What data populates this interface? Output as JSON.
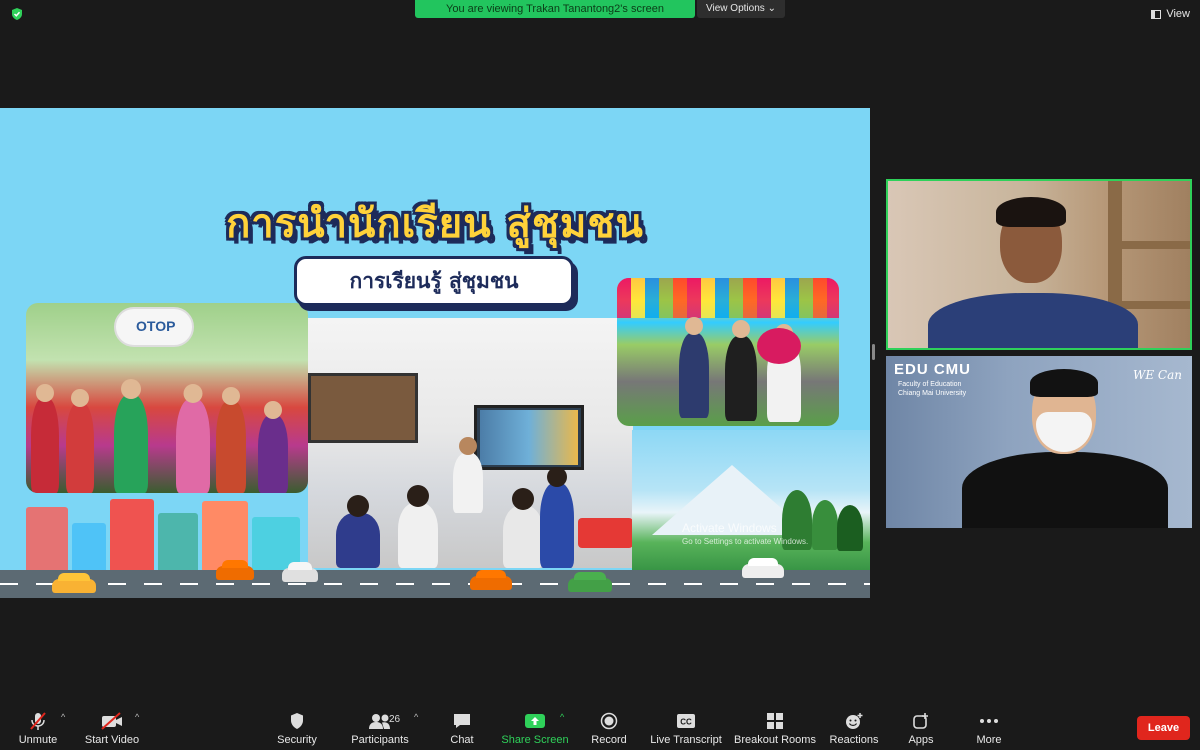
{
  "top_bar": {
    "share_banner": "You are viewing Trakan Tanantong2's screen",
    "view_options": "View Options",
    "view_button": "View"
  },
  "slide": {
    "title": "การนำนักเรียน สู่ชุมชน",
    "subtitle": "การเรียนรู้ สู่ชุมชน",
    "signboard_text": "OTOP",
    "watermark_line1": "Activate Windows",
    "watermark_line2": "Go to Settings to activate Windows."
  },
  "participants": {
    "tile2_logo": "EDU CMU",
    "tile2_logo_sub1": "Faculty of Education",
    "tile2_logo_sub2": "Chiang Mai University",
    "tile2_brand": "WE Can"
  },
  "toolbar": {
    "unmute": "Unmute",
    "start_video": "Start Video",
    "security": "Security",
    "participants": "Participants",
    "participants_count": "26",
    "chat": "Chat",
    "share_screen": "Share Screen",
    "record": "Record",
    "live_transcript": "Live Transcript",
    "breakout_rooms": "Breakout Rooms",
    "reactions": "Reactions",
    "apps": "Apps",
    "more": "More",
    "leave": "Leave",
    "cc_text": "CC"
  },
  "colors": {
    "share_green": "#22c55e",
    "active_speaker_border": "#2fd15a",
    "leave_red": "#e0261d",
    "slide_background": "#7cd6f5",
    "title_yellow": "#ffd23a"
  }
}
